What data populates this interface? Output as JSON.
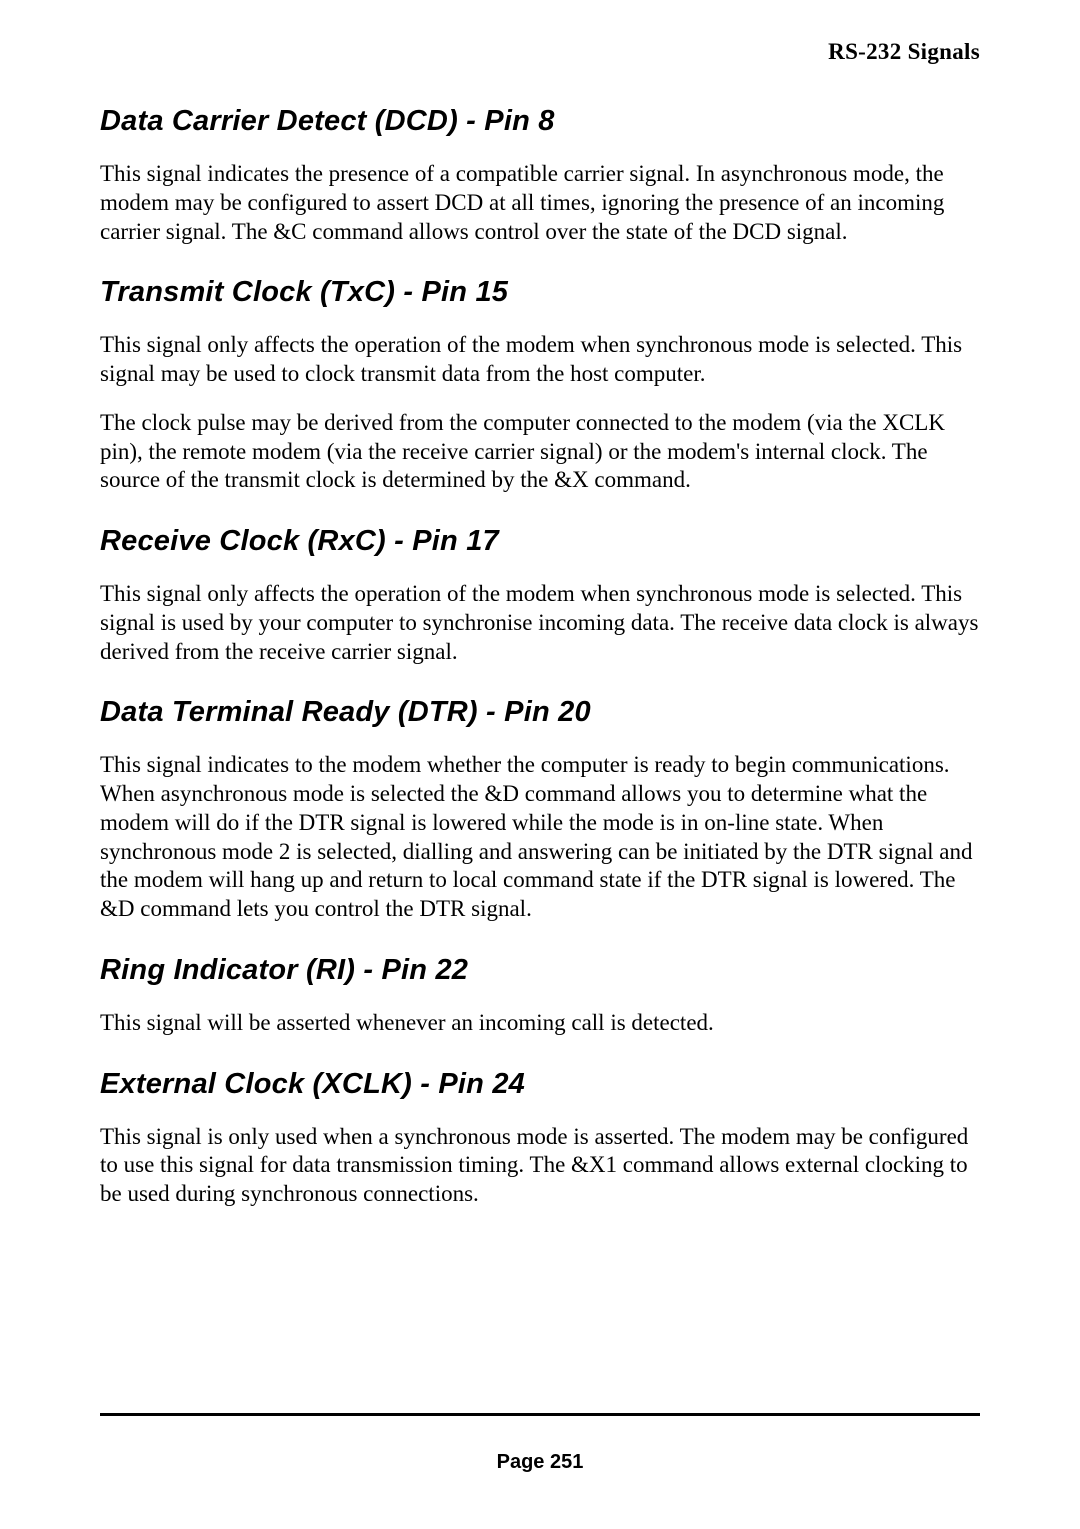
{
  "header": "RS-232 Signals",
  "sections": [
    {
      "heading": "Data Carrier Detect (DCD) - Pin 8",
      "paragraphs": [
        "This signal indicates the presence of a compatible carrier signal. In asynchronous mode, the modem may be configured to assert DCD at all times, ignoring the presence of an incoming carrier signal. The &C command allows control over the state of the DCD signal."
      ]
    },
    {
      "heading": "Transmit Clock (TxC) - Pin 15",
      "paragraphs": [
        "This signal only affects the operation of the modem when synchronous mode is selected. This signal may be used to clock transmit data from the host computer.",
        "The clock pulse may be derived from the computer connected to the modem (via the XCLK pin), the remote modem (via the receive carrier signal) or the modem's internal clock. The source of the transmit clock is determined by the &X command."
      ]
    },
    {
      "heading": "Receive Clock (RxC) - Pin 17",
      "paragraphs": [
        "This signal only affects the operation of the modem when synchronous mode is selected. This signal is used by your computer to synchronise incoming data. The receive data clock is always derived from the receive carrier signal."
      ]
    },
    {
      "heading": "Data Terminal Ready (DTR) - Pin 20",
      "paragraphs": [
        "This signal indicates to the modem whether the computer is ready to begin communications. When asynchronous mode is selected the &D command allows you to determine what the modem will do if the DTR signal is lowered while the mode is in on-line state. When synchronous mode 2 is selected, dialling and answering can be initiated by the DTR signal and the modem will hang up and return to local command state if the DTR signal is lowered. The &D command lets you control the DTR signal."
      ]
    },
    {
      "heading": "Ring Indicator (RI) - Pin 22",
      "paragraphs": [
        "This signal will be asserted whenever an incoming call is detected."
      ]
    },
    {
      "heading": "External Clock (XCLK) - Pin 24",
      "paragraphs": [
        "This signal is only used when a synchronous mode is asserted. The modem may be configured to use this signal for data transmission timing. The &X1 command allows external clocking to be used during synchronous connections."
      ]
    }
  ],
  "footer": "Page 251"
}
